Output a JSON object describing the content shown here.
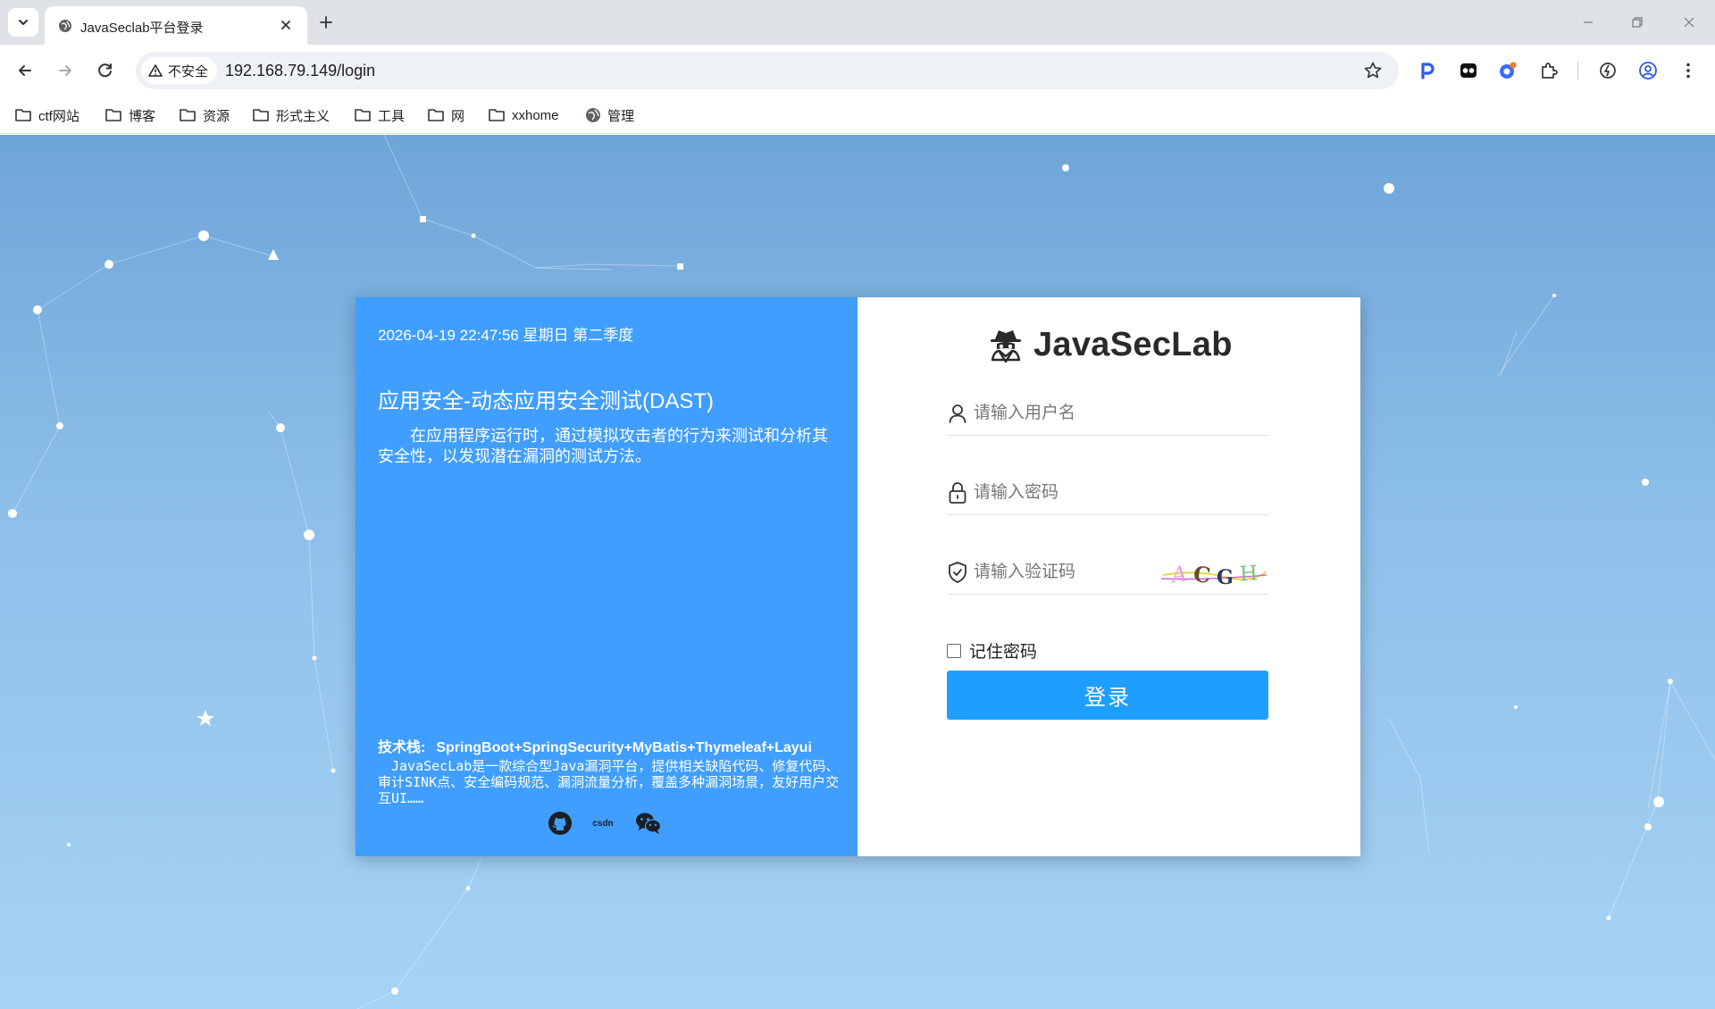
{
  "browser": {
    "tab_title": "JavaSeclab平台登录",
    "security_label": "不安全",
    "url": "192.168.79.149/login",
    "bookmarks": [
      {
        "label": "ctf网站",
        "icon": "folder-icon"
      },
      {
        "label": "博客",
        "icon": "folder-icon"
      },
      {
        "label": "资源",
        "icon": "folder-icon"
      },
      {
        "label": "形式主义",
        "icon": "folder-icon"
      },
      {
        "label": "工具",
        "icon": "folder-icon"
      },
      {
        "label": "网",
        "icon": "folder-icon"
      },
      {
        "label": "xxhome",
        "icon": "folder-icon"
      },
      {
        "label": "管理",
        "icon": "globe-icon"
      }
    ]
  },
  "intro": {
    "datetime": "2026-04-19 22:47:56 星期日 第二季度",
    "title": "应用安全-动态应用安全测试(DAST)",
    "description": "在应用程序运行时，通过模拟攻击者的行为来测试和分析其安全性，以发现潜在漏洞的测试方法。",
    "stack_label": "技术栈:",
    "stack_value": "SpringBoot+SpringSecurity+MyBatis+Thymeleaf+Layui",
    "about": "JavaSecLab是一款综合型Java漏洞平台，提供相关缺陷代码、修复代码、审计SINK点、安全编码规范、漏洞流量分析，覆盖多种漏洞场景，友好用户交互UI……",
    "social_csdn": "csdn"
  },
  "login": {
    "brand": "JavaSecLab",
    "username_placeholder": "请输入用户名",
    "password_placeholder": "请输入密码",
    "captcha_placeholder": "请输入验证码",
    "captcha_text": "ACGH",
    "remember_label": "记住密码",
    "submit_label": "登录"
  },
  "colors": {
    "left_panel": "#409efe",
    "button": "#1e9fff"
  }
}
